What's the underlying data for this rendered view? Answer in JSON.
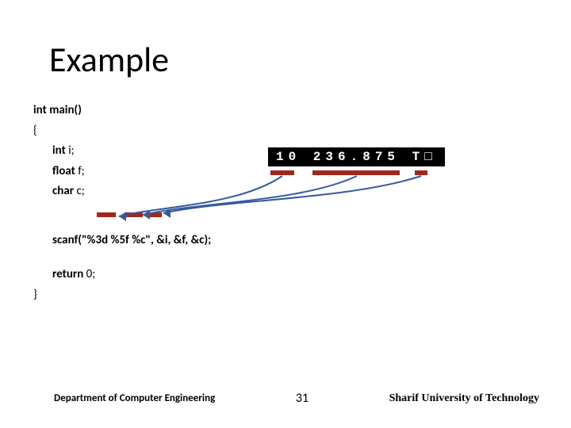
{
  "title": "Example",
  "code": {
    "l1a": "int ",
    "l1b": "main()",
    "l2": "{",
    "l3a": "int ",
    "l3b": "i;",
    "l4a": "float ",
    "l4b": "f;",
    "l5a": "char ",
    "l5b": "c;",
    "lscan_a": "scanf(",
    "lscan_b": "\"%3d %5f %c\"",
    "lscan_c": ", &i, &f, &c);",
    "lret_a": "return ",
    "lret_b": "0;",
    "lend": "}"
  },
  "input_buffer": "10  236.875  T□",
  "footer": {
    "dept": "Department of Computer Engineering",
    "page": "31",
    "uni": "Sharif University of Technology"
  }
}
